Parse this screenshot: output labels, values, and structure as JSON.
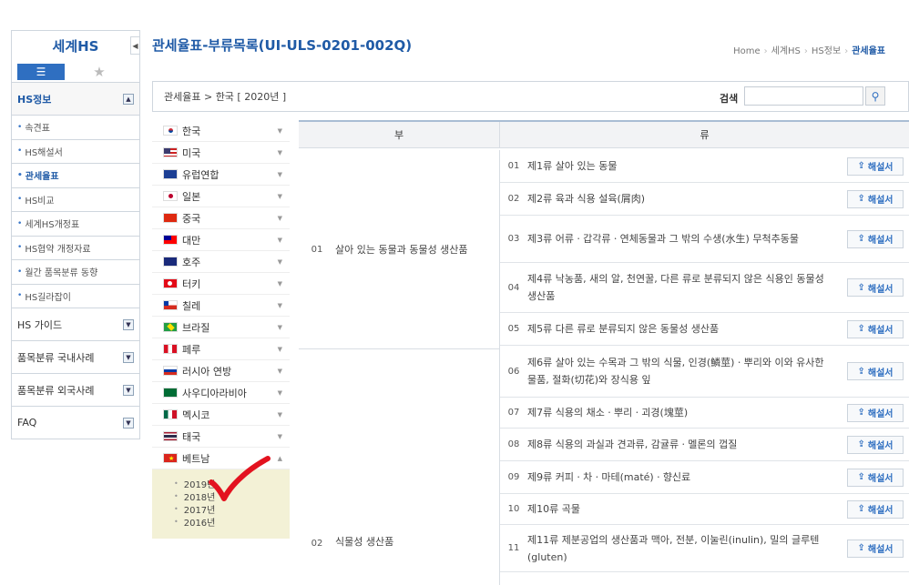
{
  "sidebar": {
    "title": "세계HS",
    "tab_list_icon": "list-icon",
    "tab_star_icon": "star-icon",
    "section_title": "HS정보",
    "items": [
      {
        "label": "속견표"
      },
      {
        "label": "HS해설서"
      },
      {
        "label": "관세율표"
      },
      {
        "label": "HS비교"
      },
      {
        "label": "세계HS개정표"
      },
      {
        "label": "HS협약 개정자료"
      },
      {
        "label": "월간 품목분류 동향"
      },
      {
        "label": "HS길라잡이"
      }
    ],
    "groups": [
      {
        "label": "HS 가이드"
      },
      {
        "label": "품목분류 국내사례"
      },
      {
        "label": "품목분류 외국사례"
      },
      {
        "label": "FAQ"
      }
    ]
  },
  "header": {
    "title": "관세율표-부류목록(UI-ULS-0201-002Q)",
    "breadcrumb": [
      "Home",
      "세계HS",
      "HS정보",
      "관세율표"
    ]
  },
  "filter": {
    "path": "관세율표 > 한국 [ 2020년 ]",
    "search_label": "검색",
    "search_value": ""
  },
  "countries": [
    {
      "name": "한국",
      "flag": "kr"
    },
    {
      "name": "미국",
      "flag": "us"
    },
    {
      "name": "유럽연합",
      "flag": "eu"
    },
    {
      "name": "일본",
      "flag": "jp"
    },
    {
      "name": "중국",
      "flag": "cn"
    },
    {
      "name": "대만",
      "flag": "tw"
    },
    {
      "name": "호주",
      "flag": "au"
    },
    {
      "name": "터키",
      "flag": "tr"
    },
    {
      "name": "칠레",
      "flag": "cl"
    },
    {
      "name": "브라질",
      "flag": "br"
    },
    {
      "name": "페루",
      "flag": "pe"
    },
    {
      "name": "러시아 연방",
      "flag": "ru"
    },
    {
      "name": "사우디아라비아",
      "flag": "sa"
    },
    {
      "name": "멕시코",
      "flag": "mx"
    },
    {
      "name": "태국",
      "flag": "th"
    },
    {
      "name": "베트남",
      "flag": "vn"
    }
  ],
  "years": [
    "2019년",
    "2018년",
    "2017년",
    "2016년"
  ],
  "table": {
    "col_bu": "부",
    "col_ryu": "류",
    "sections": [
      {
        "code": "01",
        "name": "살아 있는 동물과 동물성 생산품"
      },
      {
        "code": "02",
        "name": "식물성 생산품"
      }
    ],
    "rows": [
      {
        "code": "01",
        "name": "제1류 살아 있는 동물"
      },
      {
        "code": "02",
        "name": "제2류 육과 식용 설육(屑肉)"
      },
      {
        "code": "03",
        "name": "제3류 어류ㆍ갑각류ㆍ연체동물과 그 밖의 수생(水生) 무척추동물"
      },
      {
        "code": "04",
        "name": "제4류 낙농품, 새의 알, 천연꿀, 다른 류로 분류되지 않은 식용인 동물성 생산품"
      },
      {
        "code": "05",
        "name": "제5류 다른 류로 분류되지 않은 동물성 생산품"
      },
      {
        "code": "06",
        "name": "제6류 살아 있는 수목과 그 밖의 식물, 인경(鱗莖)ㆍ뿌리와 이와 유사한 물품, 절화(切花)와 장식용 잎"
      },
      {
        "code": "07",
        "name": "제7류 식용의 채소ㆍ뿌리ㆍ괴경(塊莖)"
      },
      {
        "code": "08",
        "name": "제8류 식용의 과실과 견과류, 감귤류ㆍ멜론의 껍질"
      },
      {
        "code": "09",
        "name": "제9류 커피ㆍ차ㆍ마테(maté)ㆍ향신료"
      },
      {
        "code": "10",
        "name": "제10류 곡물"
      },
      {
        "code": "11",
        "name": "제11류 제분공업의 생산품과 맥아, 전분, 이눌린(inulin), 밀의 글루텐(gluten)"
      }
    ],
    "button_label": "해설서"
  }
}
